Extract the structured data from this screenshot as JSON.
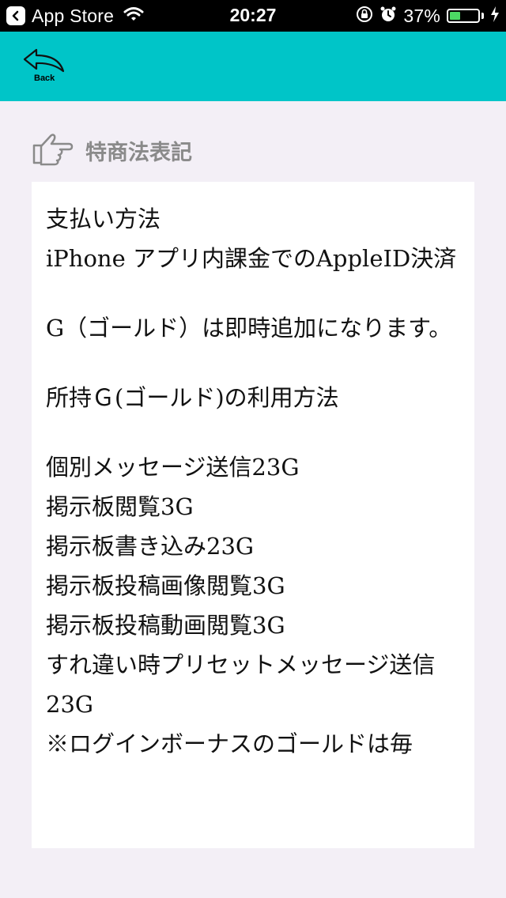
{
  "status_bar": {
    "back_app": "App Store",
    "time": "20:27",
    "battery_percent": "37%",
    "battery_level": 0.37,
    "icons": [
      "back-arrow-icon",
      "wifi-icon",
      "orientation-lock-icon",
      "alarm-icon",
      "battery-icon",
      "charging-icon"
    ]
  },
  "nav": {
    "back_label": "Back",
    "accent": "#00c5c8"
  },
  "section": {
    "title": "特商法表記",
    "icon": "pointing-hand-icon"
  },
  "content": {
    "payment_heading": "支払い方法",
    "payment_detail": "iPhone アプリ内課金でのAppleID決済",
    "gold_note": "G（ゴールド）は即時追加になります。",
    "usage_heading": "所持Ｇ(ゴールド)の利用方法",
    "usage_items": [
      "個別メッセージ送信23G",
      "掲示板閲覧3G",
      "掲示板書き込み23G",
      "掲示板投稿画像閲覧3G",
      "掲示板投稿動画閲覧3G",
      "すれ違い時プリセットメッセージ送信23G"
    ],
    "footnote": "※ログインボーナスのゴールドは毎"
  }
}
